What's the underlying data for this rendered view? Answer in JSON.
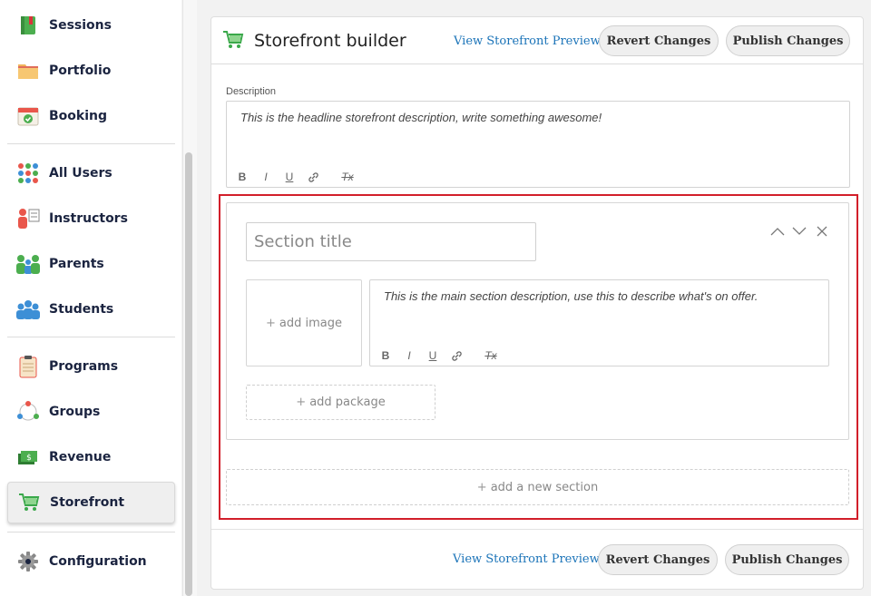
{
  "sidebar": {
    "items": [
      {
        "label": "Sessions",
        "icon": "book-icon"
      },
      {
        "label": "Portfolio",
        "icon": "folder-icon"
      },
      {
        "label": "Booking",
        "icon": "calendar-check-icon"
      },
      {
        "label": "All Users",
        "icon": "users-grid-icon"
      },
      {
        "label": "Instructors",
        "icon": "instructor-icon"
      },
      {
        "label": "Parents",
        "icon": "parents-icon"
      },
      {
        "label": "Students",
        "icon": "students-icon"
      },
      {
        "label": "Programs",
        "icon": "clipboard-icon"
      },
      {
        "label": "Groups",
        "icon": "groups-icon"
      },
      {
        "label": "Revenue",
        "icon": "money-icon"
      },
      {
        "label": "Storefront",
        "icon": "cart-icon",
        "active": true
      },
      {
        "label": "Configuration",
        "icon": "gear-icon"
      }
    ]
  },
  "header": {
    "title": "Storefront builder",
    "preview_link": "View Storefront Preview",
    "revert_label": "Revert Changes",
    "publish_label": "Publish Changes"
  },
  "description": {
    "label": "Description",
    "placeholder": "This is the headline storefront description, write something awesome!"
  },
  "section": {
    "title_placeholder": "Section title",
    "add_image": "add image",
    "description_placeholder": "This is the main section description, use this to describe what's on offer.",
    "add_package": "add package"
  },
  "add_section": "add a new section",
  "footer": {
    "preview_link": "View Storefront Preview",
    "revert_label": "Revert Changes",
    "publish_label": "Publish Changes"
  },
  "colors": {
    "accent_link": "#1a73b8",
    "highlight_border": "#d21f2a",
    "cart_green": "#3aa84a"
  }
}
